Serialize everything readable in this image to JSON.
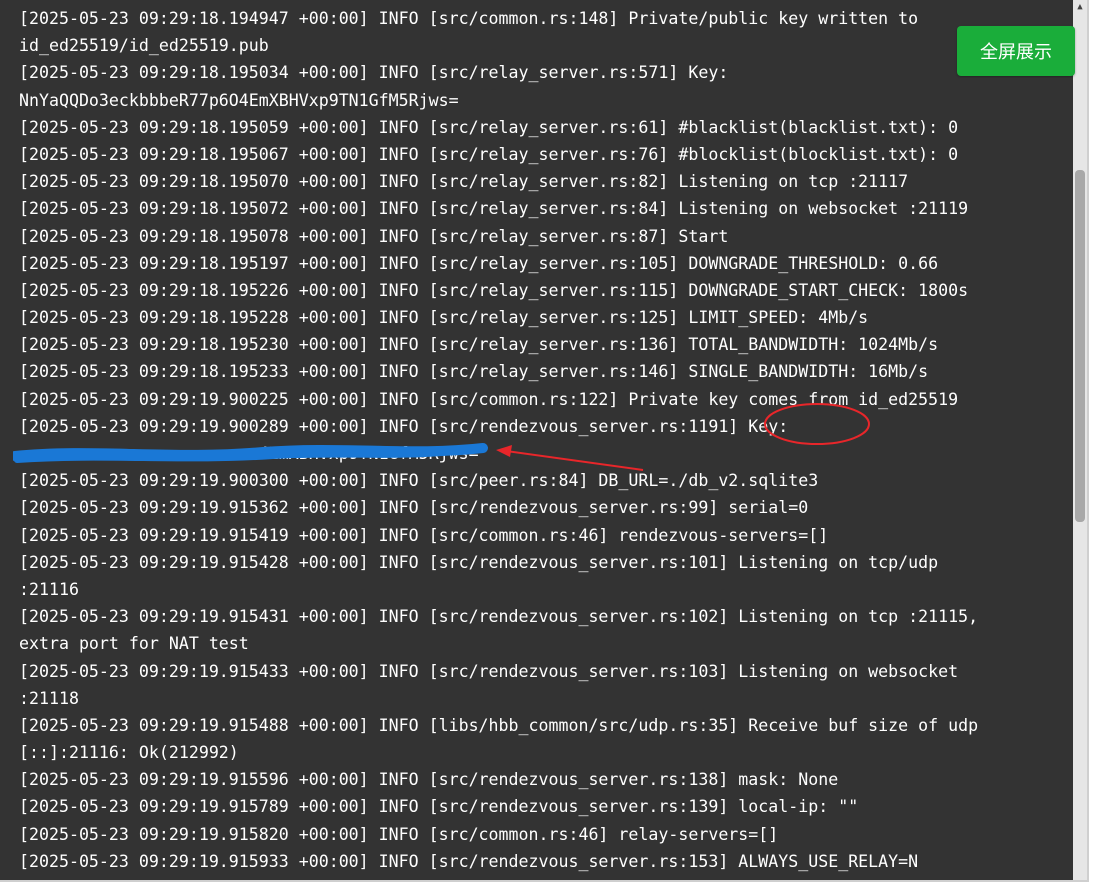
{
  "colors": {
    "console_bg": "#333333",
    "log_text": "#ffffff",
    "button_bg": "#1aad3a",
    "annotation_red": "#e8262a",
    "redaction_blue": "#1a78d6"
  },
  "fullscreen_button": {
    "label": "全屏展示"
  },
  "log": {
    "lines": [
      "[2025-05-23 09:29:18.194947 +00:00] INFO [src/common.rs:148] Private/public key written to",
      "id_ed25519/id_ed25519.pub",
      "[2025-05-23 09:29:18.195034 +00:00] INFO [src/relay_server.rs:571] Key:",
      "NnYaQQDo3eckbbbeR77p6O4EmXBHVxp9TN1GfM5Rjws=",
      "[2025-05-23 09:29:18.195059 +00:00] INFO [src/relay_server.rs:61] #blacklist(blacklist.txt): 0",
      "[2025-05-23 09:29:18.195067 +00:00] INFO [src/relay_server.rs:76] #blocklist(blocklist.txt): 0",
      "[2025-05-23 09:29:18.195070 +00:00] INFO [src/relay_server.rs:82] Listening on tcp :21117",
      "[2025-05-23 09:29:18.195072 +00:00] INFO [src/relay_server.rs:84] Listening on websocket :21119",
      "[2025-05-23 09:29:18.195078 +00:00] INFO [src/relay_server.rs:87] Start",
      "[2025-05-23 09:29:18.195197 +00:00] INFO [src/relay_server.rs:105] DOWNGRADE_THRESHOLD: 0.66",
      "[2025-05-23 09:29:18.195226 +00:00] INFO [src/relay_server.rs:115] DOWNGRADE_START_CHECK: 1800s",
      "[2025-05-23 09:29:18.195228 +00:00] INFO [src/relay_server.rs:125] LIMIT_SPEED: 4Mb/s",
      "[2025-05-23 09:29:18.195230 +00:00] INFO [src/relay_server.rs:136] TOTAL_BANDWIDTH: 1024Mb/s",
      "[2025-05-23 09:29:18.195233 +00:00] INFO [src/relay_server.rs:146] SINGLE_BANDWIDTH: 16Mb/s",
      "[2025-05-23 09:29:19.900225 +00:00] INFO [src/common.rs:122] Private key comes from id_ed25519",
      "[2025-05-23 09:29:19.900289 +00:00] INFO [src/rendezvous_server.rs:1191] Key:",
      "4EmXBHVxp9TN1GfM5Rjws=",
      "[2025-05-23 09:29:19.900300 +00:00] INFO [src/peer.rs:84] DB_URL=./db_v2.sqlite3",
      "[2025-05-23 09:29:19.915362 +00:00] INFO [src/rendezvous_server.rs:99] serial=0",
      "[2025-05-23 09:29:19.915419 +00:00] INFO [src/common.rs:46] rendezvous-servers=[]",
      "[2025-05-23 09:29:19.915428 +00:00] INFO [src/rendezvous_server.rs:101] Listening on tcp/udp",
      ":21116",
      "[2025-05-23 09:29:19.915431 +00:00] INFO [src/rendezvous_server.rs:102] Listening on tcp :21115,",
      "extra port for NAT test",
      "[2025-05-23 09:29:19.915433 +00:00] INFO [src/rendezvous_server.rs:103] Listening on websocket",
      ":21118",
      "[2025-05-23 09:29:19.915488 +00:00] INFO [libs/hbb_common/src/udp.rs:35] Receive buf size of udp",
      "[::]:21116: Ok(212992)",
      "[2025-05-23 09:29:19.915596 +00:00] INFO [src/rendezvous_server.rs:138] mask: None",
      "[2025-05-23 09:29:19.915789 +00:00] INFO [src/rendezvous_server.rs:139] local-ip: \"\"",
      "[2025-05-23 09:29:19.915820 +00:00] INFO [src/common.rs:46] relay-servers=[]",
      "[2025-05-23 09:29:19.915933 +00:00] INFO [src/rendezvous_server.rs:153] ALWAYS_USE_RELAY=N"
    ]
  }
}
